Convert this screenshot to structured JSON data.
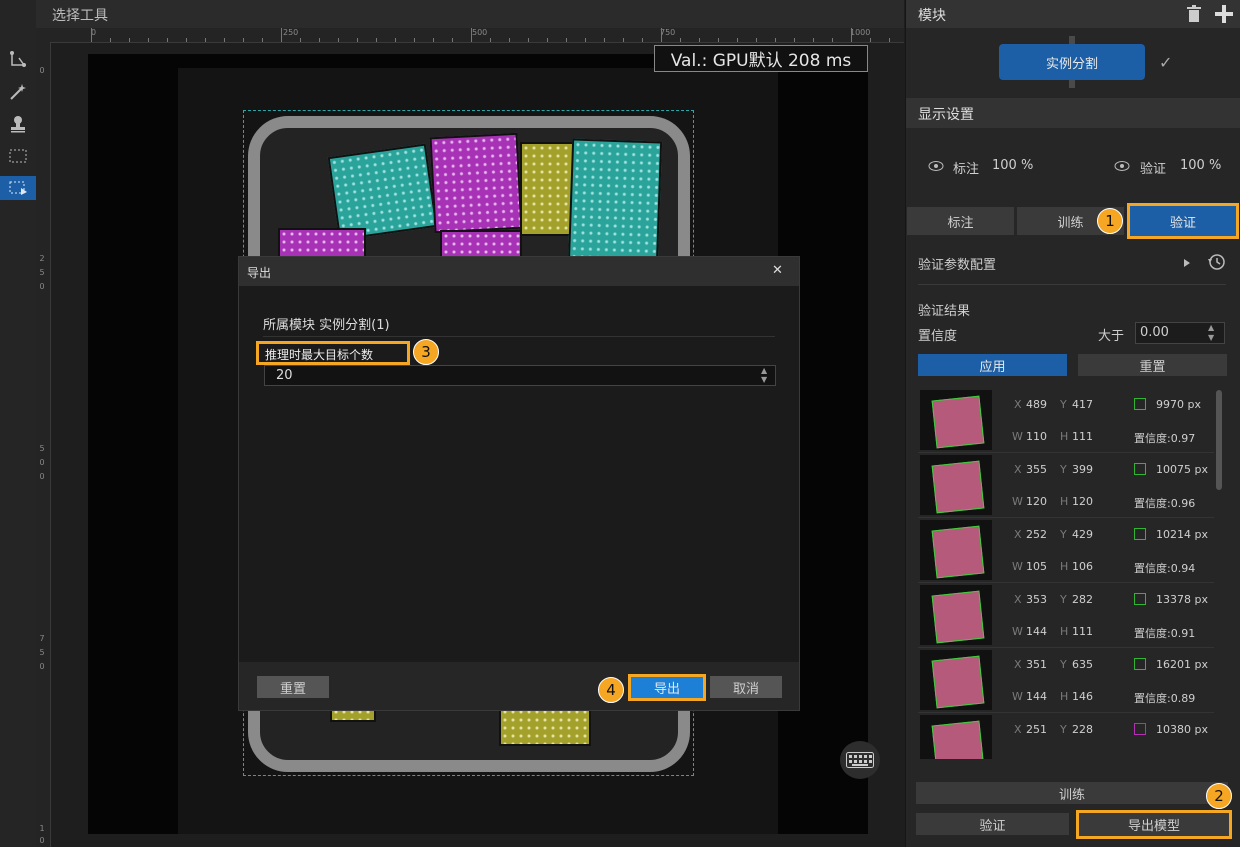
{
  "toolbar": {
    "tools": [
      "polygon-tool-icon",
      "magic-wand-icon",
      "stamp-icon",
      "rect-select-icon",
      "box-tool-icon"
    ]
  },
  "title_bar": {
    "title": "选择工具"
  },
  "ruler": {
    "top_labels": [
      "0",
      "250",
      "500",
      "750",
      "1000"
    ],
    "left_labels": [
      [
        "0"
      ],
      [
        "2",
        "5",
        "0"
      ],
      [
        "5",
        "0",
        "0"
      ],
      [
        "7",
        "5",
        "0"
      ],
      [
        "1",
        "0"
      ]
    ]
  },
  "canvas": {
    "val_label": "Val.: GPU默认 208 ms"
  },
  "module_panel": {
    "header": "模块",
    "module_button": "实例分割",
    "check": "✓"
  },
  "display_settings": {
    "header": "显示设置",
    "annotation_label": "标注",
    "annotation_opacity": "100 %",
    "validation_label": "验证",
    "validation_opacity": "100 %"
  },
  "tabs": [
    "标注",
    "训练",
    "验证"
  ],
  "validation_config": {
    "label": "验证参数配置"
  },
  "validation_results": {
    "header": "验证结果",
    "confidence_label": "置信度",
    "greater_than": "大于",
    "confidence_value": "0.00",
    "apply": "应用",
    "reset": "重置",
    "rows": [
      {
        "x": "489",
        "y": "417",
        "w": "110",
        "h": "111",
        "px": "9970 px",
        "conf": "置信度:0.97",
        "color": "#2fb52f"
      },
      {
        "x": "355",
        "y": "399",
        "w": "120",
        "h": "120",
        "px": "10075 px",
        "conf": "置信度:0.96",
        "color": "#2fb52f"
      },
      {
        "x": "252",
        "y": "429",
        "w": "105",
        "h": "106",
        "px": "10214 px",
        "conf": "置信度:0.94",
        "color": "#2fb52f"
      },
      {
        "x": "353",
        "y": "282",
        "w": "144",
        "h": "111",
        "px": "13378 px",
        "conf": "置信度:0.91",
        "color": "#2fb52f"
      },
      {
        "x": "351",
        "y": "635",
        "w": "144",
        "h": "146",
        "px": "16201 px",
        "conf": "置信度:0.89",
        "color": "#2fb52f"
      },
      {
        "x": "251",
        "y": "228",
        "w": "",
        "h": "",
        "px": "10380 px",
        "conf": "",
        "color": "#b52fb5"
      }
    ]
  },
  "bottom_buttons": {
    "train": "训练",
    "validate": "验证",
    "export_model": "导出模型"
  },
  "dialog": {
    "title": "导出",
    "close": "✕",
    "module_line": "所属模块 实例分割(1)",
    "max_targets_label": "推理时最大目标个数",
    "max_targets_value": "20",
    "reset": "重置",
    "export": "导出",
    "cancel": "取消"
  },
  "badges": [
    "1",
    "2",
    "3",
    "4"
  ],
  "colors": {
    "accent": "#1d5fa6",
    "highlight": "#f5a623"
  }
}
